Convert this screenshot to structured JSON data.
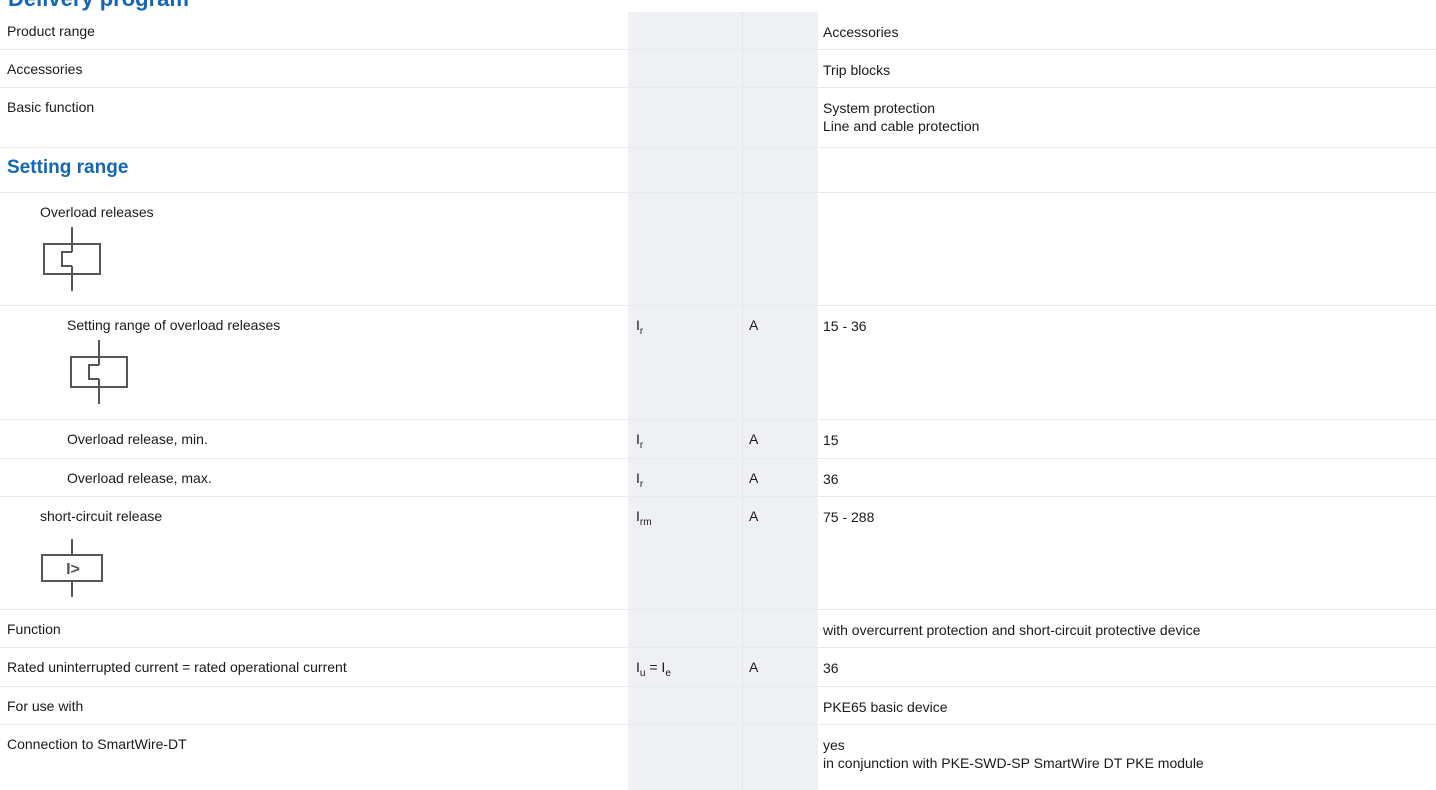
{
  "header": {
    "title": "Delivery program"
  },
  "rows": [
    {
      "label": "Product range",
      "symbol": "",
      "unit": "",
      "values": [
        "Accessories"
      ]
    },
    {
      "label": "Accessories",
      "symbol": "",
      "unit": "",
      "values": [
        "Trip blocks"
      ]
    },
    {
      "label": "Basic function",
      "symbol": "",
      "unit": "",
      "values": [
        "System protection",
        "Line and cable protection"
      ]
    },
    {
      "section": "Setting range"
    },
    {
      "label": "Overload releases",
      "icon": "overload-release-icon"
    },
    {
      "label": "Setting range of overload releases",
      "icon": "overload-release-icon",
      "symbol": "I",
      "symbol_sub": "r",
      "unit": "A",
      "values": [
        "15 - 36"
      ]
    },
    {
      "label": "Overload release, min.",
      "symbol": "I",
      "symbol_sub": "r",
      "unit": "A",
      "values": [
        "15"
      ]
    },
    {
      "label": "Overload release, max.",
      "symbol": "I",
      "symbol_sub": "r",
      "unit": "A",
      "values": [
        "36"
      ]
    },
    {
      "label": "short-circuit release",
      "icon": "short-circuit-release-icon",
      "symbol": "I",
      "symbol_sub": "rm",
      "unit": "A",
      "values": [
        "75 - 288"
      ],
      "icon_text": "I>"
    },
    {
      "label": "Function",
      "symbol": "",
      "unit": "",
      "values": [
        "with overcurrent protection and short-circuit protective device"
      ]
    },
    {
      "label": "Rated uninterrupted current = rated operational current",
      "symbol_a": "I",
      "symbol_a_sub": "u",
      "symbol_mid": " = ",
      "symbol_b": "I",
      "symbol_b_sub": "e",
      "unit": "A",
      "values": [
        "36"
      ]
    },
    {
      "label": "For use with",
      "symbol": "",
      "unit": "",
      "values": [
        "PKE65 basic device"
      ]
    },
    {
      "label": "Connection to SmartWire-DT",
      "symbol": "",
      "unit": "",
      "values": [
        "yes",
        "in conjunction with PKE-SWD-SP SmartWire DT PKE module"
      ]
    }
  ]
}
